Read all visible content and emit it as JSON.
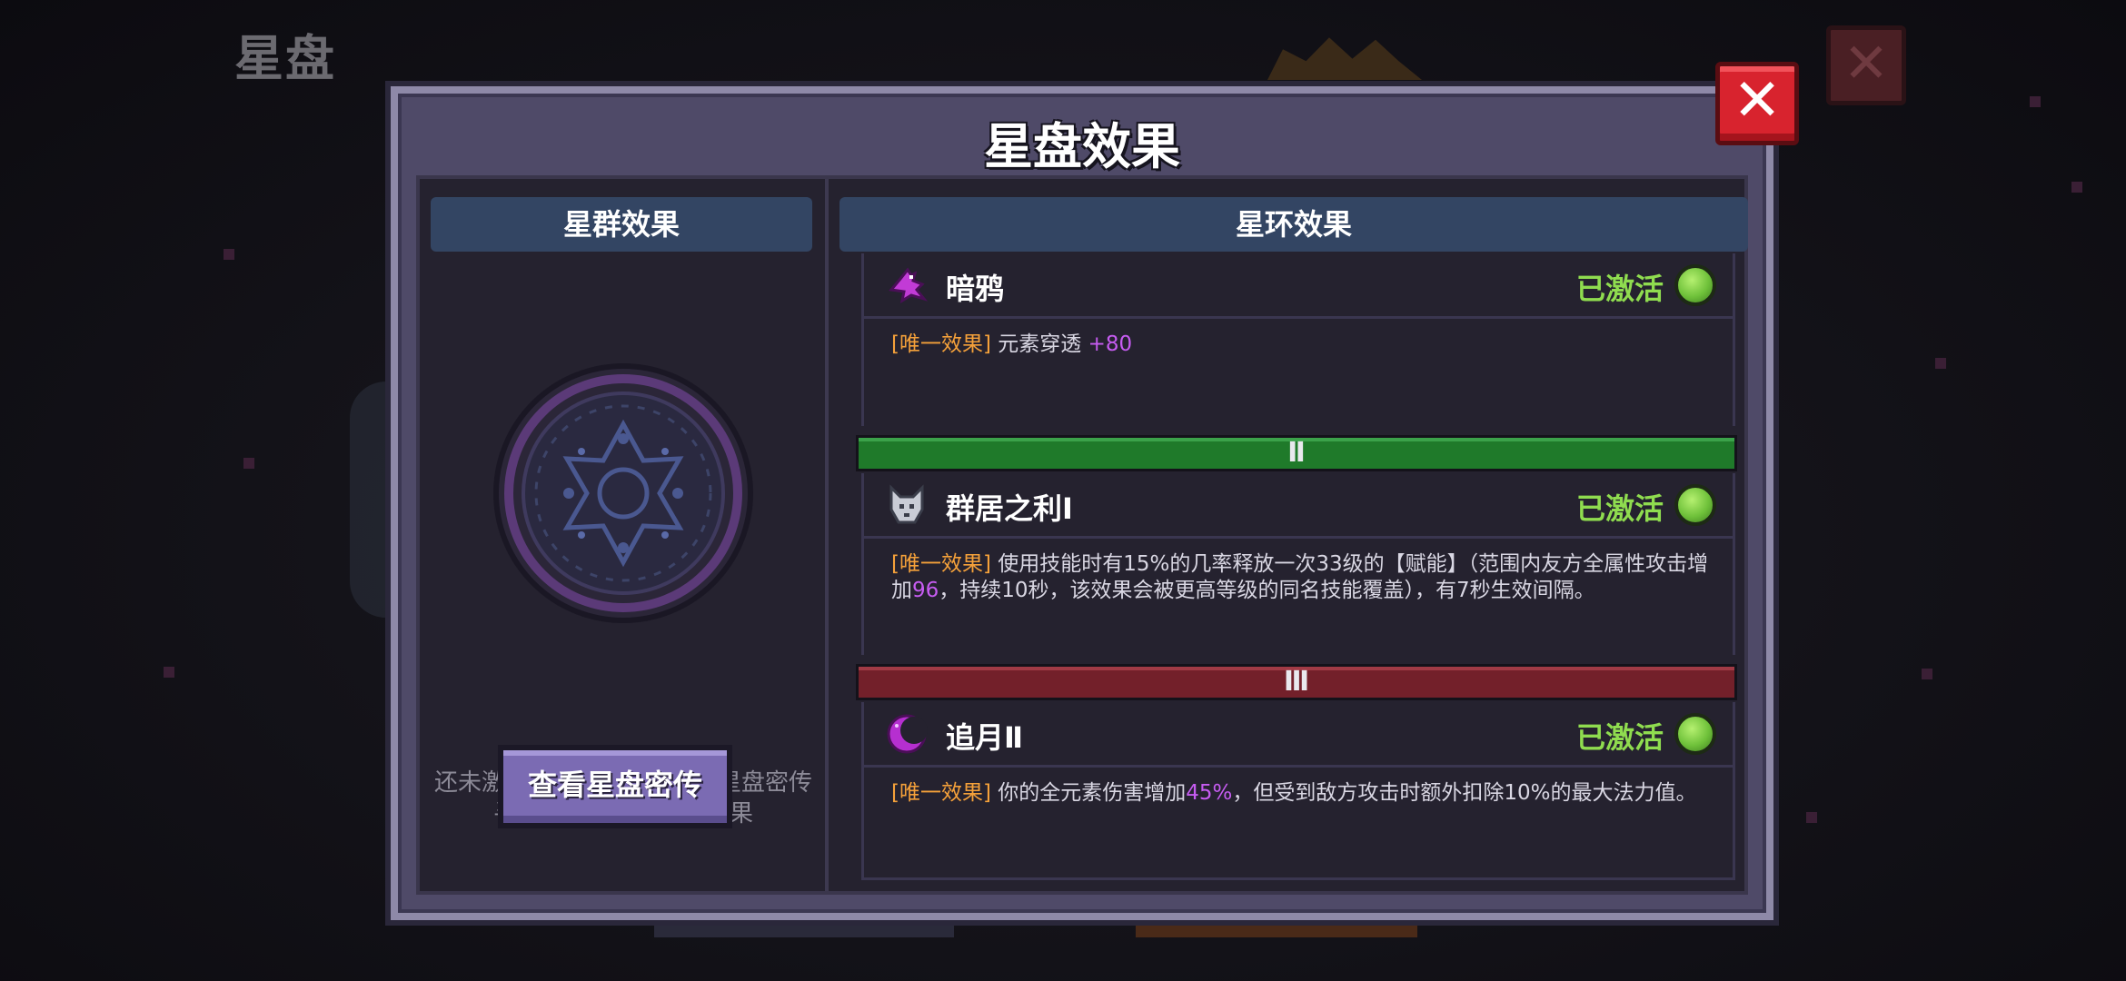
{
  "background": {
    "title": "星盘"
  },
  "dialog": {
    "title": "星盘效果",
    "left_panel": {
      "header": "星群效果",
      "hint": "还未激活星环效果，请查看星盘密传寻找提示，激活星环效果",
      "button_label": "查看星盘密传"
    },
    "right_panel": {
      "header": "星环效果",
      "rings": [
        {
          "name": "暗鸦",
          "status": "已激活",
          "icon": "crow-icon",
          "tag": "[唯一效果]",
          "desc_1": "元素穿透",
          "value_1": "+80",
          "desc_2": "",
          "value_2": "",
          "desc_3": ""
        },
        {
          "name": "群居之利Ⅰ",
          "status": "已激活",
          "icon": "wolf-icon",
          "tag": "[唯一效果]",
          "desc_1": "使用技能时有15%的几率释放一次33级的【赋能】（范围内友方全属性攻击增加",
          "value_1": "96",
          "desc_2": "，持续10秒，该效果会被更高等级的同名技能覆盖），有7秒生效间隔。",
          "value_2": "",
          "desc_3": ""
        },
        {
          "name": "追月Ⅱ",
          "status": "已激活",
          "icon": "moon-icon",
          "tag": "[唯一效果]",
          "desc_1": "你的全元素伤害增加",
          "value_1": "45%",
          "desc_2": "，但受到敌方攻击时额外扣除10%的最大法力值。",
          "value_2": "",
          "desc_3": ""
        }
      ],
      "tiers": [
        "Ⅱ",
        "Ⅲ"
      ]
    }
  },
  "colors": {
    "activated": "#8fdc4f",
    "tag": "#f5a13a",
    "highlight": "#c65cf1",
    "tier_green": "#1f7a2a",
    "tier_red": "#73202a",
    "header_bg": "#334563",
    "close_red": "#d8232e"
  }
}
